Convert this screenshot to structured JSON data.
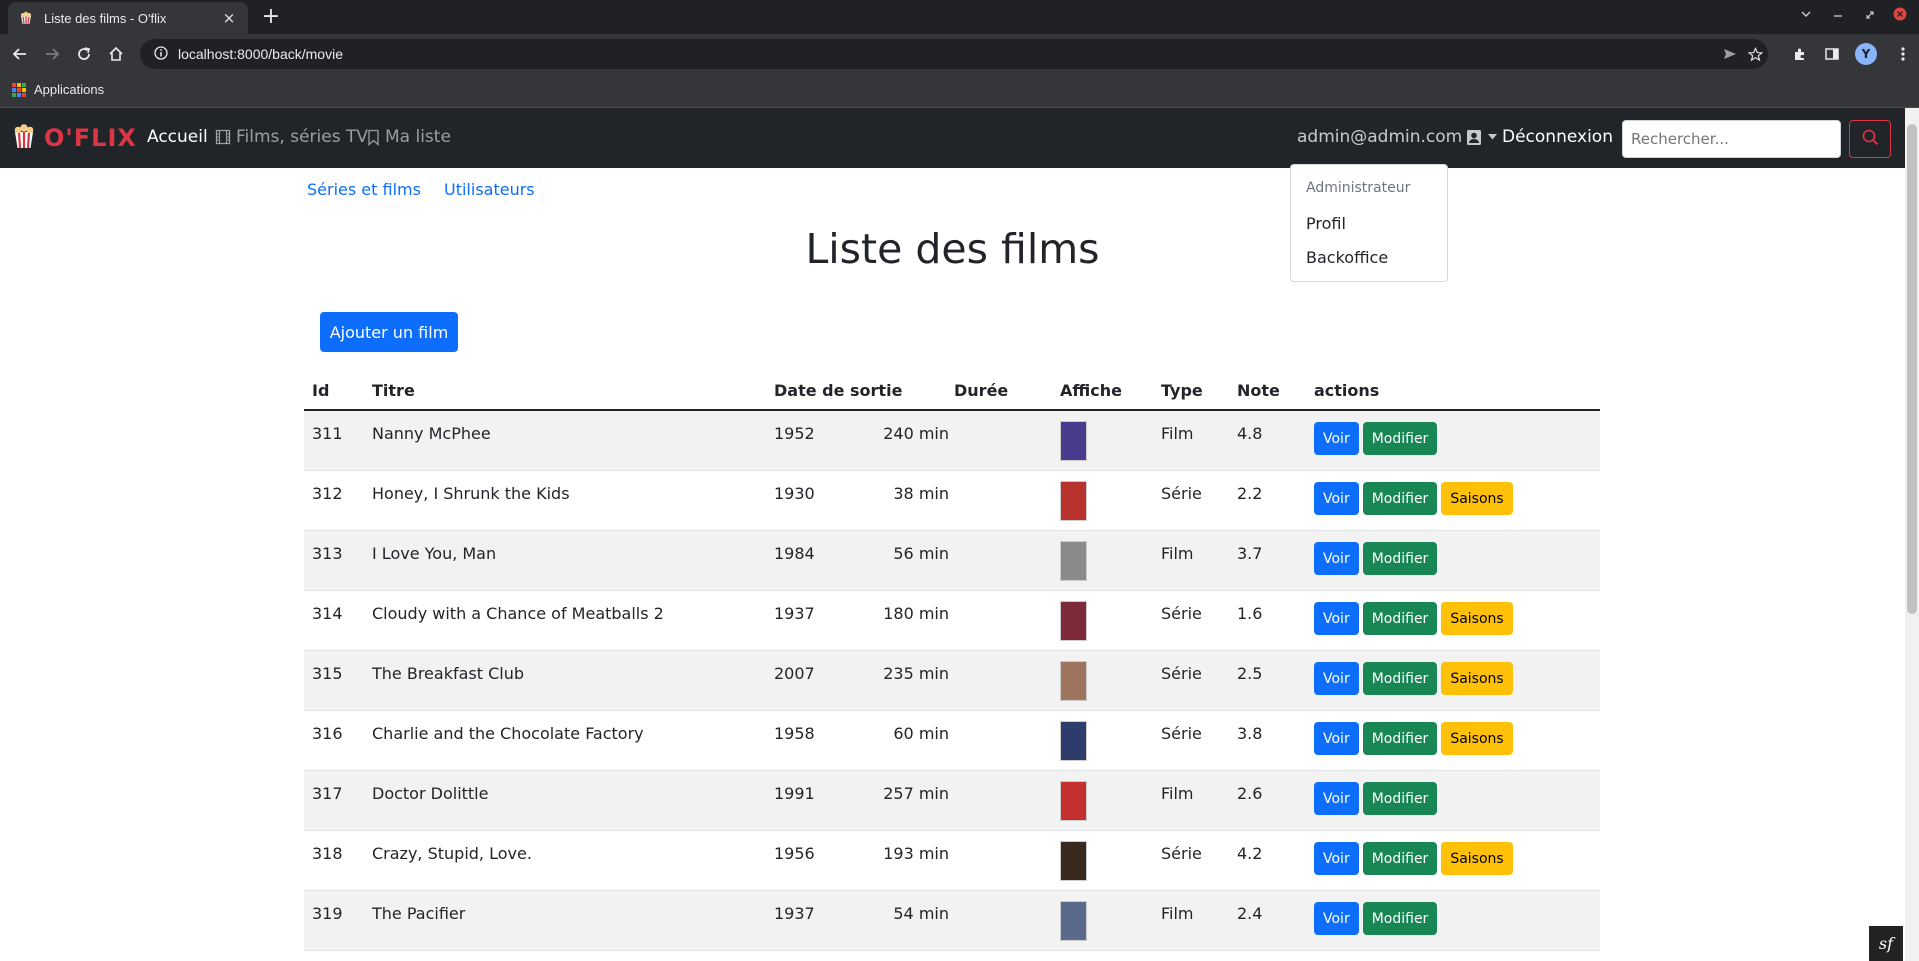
{
  "browser": {
    "tab_title": "Liste des films - O'flix",
    "tab_close": "×",
    "new_tab": "+",
    "url": "localhost:8000/back/movie",
    "bookmark_apps_label": "Applications",
    "avatar_letter": "Y"
  },
  "navbar": {
    "brand": "O'FLIX",
    "home": "Accueil",
    "movies": "Films, séries TV",
    "mylist": "Ma liste",
    "user_email": "admin@admin.com",
    "logout": "Déconnexion",
    "search_placeholder": "Rechercher..."
  },
  "user_dropdown": {
    "header": "Administrateur",
    "items": [
      "Profil",
      "Backoffice"
    ]
  },
  "subnav": [
    "Séries et films",
    "Utilisateurs"
  ],
  "page_title": "Liste des films",
  "add_button": "Ajouter un film",
  "table": {
    "headers": [
      "Id",
      "Titre",
      "Date de sortie",
      "Durée",
      "Affiche",
      "Type",
      "Note",
      "actions"
    ],
    "rows": [
      {
        "id": "311",
        "title": "Nanny McPhee",
        "date": "1952",
        "duration": "240 min",
        "type": "Film",
        "note": "4.8",
        "seasons": false
      },
      {
        "id": "312",
        "title": "Honey, I Shrunk the Kids",
        "date": "1930",
        "duration": "38 min",
        "type": "Série",
        "note": "2.2",
        "seasons": true
      },
      {
        "id": "313",
        "title": "I Love You, Man",
        "date": "1984",
        "duration": "56 min",
        "type": "Film",
        "note": "3.7",
        "seasons": false
      },
      {
        "id": "314",
        "title": "Cloudy with a Chance of Meatballs 2",
        "date": "1937",
        "duration": "180 min",
        "type": "Série",
        "note": "1.6",
        "seasons": true
      },
      {
        "id": "315",
        "title": "The Breakfast Club",
        "date": "2007",
        "duration": "235 min",
        "type": "Série",
        "note": "2.5",
        "seasons": true
      },
      {
        "id": "316",
        "title": "Charlie and the Chocolate Factory",
        "date": "1958",
        "duration": "60 min",
        "type": "Série",
        "note": "3.8",
        "seasons": true
      },
      {
        "id": "317",
        "title": "Doctor Dolittle",
        "date": "1991",
        "duration": "257 min",
        "type": "Film",
        "note": "2.6",
        "seasons": false
      },
      {
        "id": "318",
        "title": "Crazy, Stupid, Love.",
        "date": "1956",
        "duration": "193 min",
        "type": "Série",
        "note": "4.2",
        "seasons": true
      },
      {
        "id": "319",
        "title": "The Pacifier",
        "date": "1937",
        "duration": "54 min",
        "type": "Film",
        "note": "2.4",
        "seasons": false
      }
    ],
    "btn_voir": "Voir",
    "btn_modifier": "Modifier",
    "btn_saisons": "Saisons"
  },
  "symfony_badge": "sf",
  "colors": {
    "brand": "#dc3545",
    "primary": "#0d6efd",
    "success": "#198754",
    "warning": "#ffc107",
    "navbar_bg": "#212529"
  },
  "poster_colors": [
    "#4a3b8c",
    "#b8322e",
    "#8a8a8a",
    "#7d2b3a",
    "#a07560",
    "#2e3c6b",
    "#c43030",
    "#3a2a1e",
    "#5a6a8a"
  ]
}
